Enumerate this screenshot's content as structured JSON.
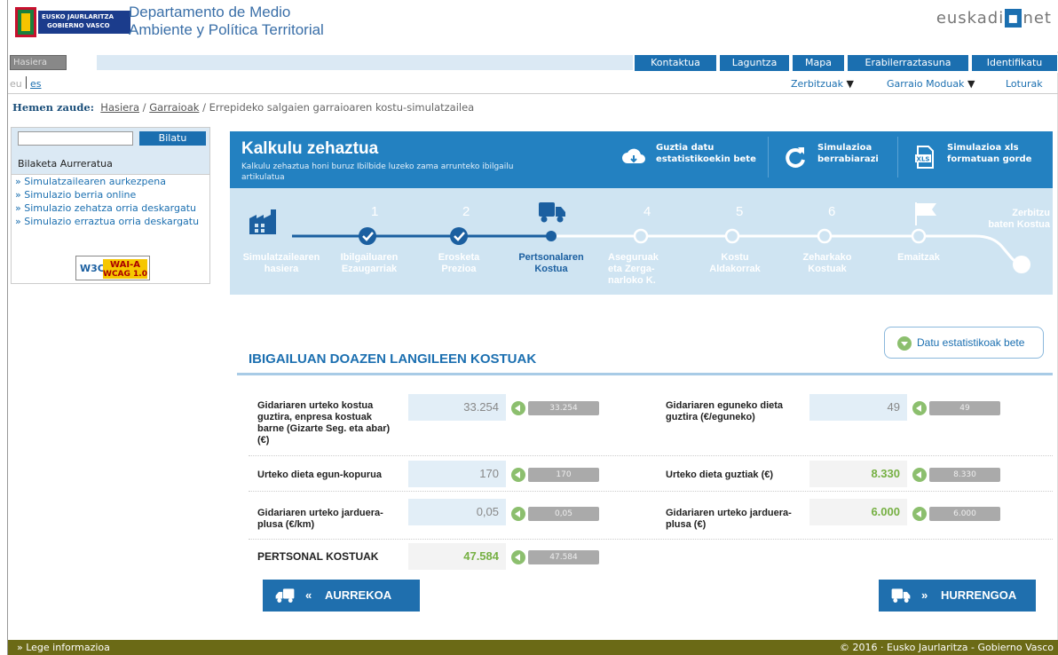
{
  "header": {
    "logo_line1": "EUSKO JAURLARITZA",
    "logo_line2": "GOBIERNO VASCO",
    "dept_line1": "Departamento de Medio",
    "dept_line2": "Ambiente y Política Territorial",
    "portal_pre": "euskadi",
    "portal_post": "net"
  },
  "topbar": {
    "home": "Hasiera",
    "links": [
      "Kontaktua",
      "Laguntza",
      "Mapa",
      "Erabilerraztasuna",
      "Identifikatu"
    ]
  },
  "langbar": {
    "eu": "eu",
    "es": "es",
    "menus": [
      "Zerbitzuak",
      "Garraio Moduak"
    ],
    "loturak": "Loturak"
  },
  "breadcrumb": {
    "label": "Hemen zaude:",
    "items": [
      "Hasiera",
      "Garraioak"
    ],
    "current": "Errepideko salgaien garraioaren kostu-simulatzailea"
  },
  "sidebar": {
    "search_button": "Bilatu",
    "advanced": "Bilaketa Aurreratua",
    "items": [
      "» Simulatzailearen aurkezpena",
      "» Simulazio berria online",
      "» Simulazio zehatza orria deskargatu",
      "» Simulazio erraztua orria deskargatu"
    ],
    "wai_w3c": "W3C",
    "wai_level": "WAI-A",
    "wai_version": "WCAG 1.0"
  },
  "banner": {
    "title": "Kalkulu zehaztua",
    "subtitle": "Kalkulu zehaztua honi buruz Ibilbide luzeko zama arrunteko ibilgailu artikulatua",
    "actions": [
      {
        "line1": "Guztia datu",
        "line2": "estatistikoekin bete"
      },
      {
        "line1": "Simulazioa",
        "line2": "berrabiarazi"
      },
      {
        "line1": "Simulazioa xls",
        "line2": "formatuan gorde"
      }
    ]
  },
  "steps": {
    "numbers": [
      "1",
      "2",
      "4",
      "5",
      "6"
    ],
    "labels": [
      [
        "Simulatzailearen",
        "hasiera"
      ],
      [
        "Ibilgailuaren",
        "Ezaugarriak"
      ],
      [
        "Erosketa",
        "Prezioa"
      ],
      [
        "Pertsonalaren",
        "Kostua"
      ],
      [
        "Aseguruak",
        "eta Zerga-",
        "narloko K."
      ],
      [
        "Kostu",
        "Aldakorrak"
      ],
      [
        "Zeharkako",
        "Kostuak"
      ],
      [
        "Emaitzak"
      ],
      [
        "Zerbitzu",
        "baten Kostua"
      ]
    ],
    "active_index": 3
  },
  "section": {
    "title": "IBIGAILUAN DOAZEN LANGILEEN KOSTUAK",
    "stats_button": "Datu estatistikoak bete"
  },
  "fields": {
    "f1": {
      "label": "Gidariaren urteko kostua guztira, enpresa kostuak barne (Gizarte Seg. eta abar) (€)",
      "value": "33.254",
      "ref": "33.254"
    },
    "f2": {
      "label": "Gidariaren eguneko dieta guztira (€/eguneko)",
      "value": "49",
      "ref": "49"
    },
    "f3": {
      "label": "Urteko dieta egun-kopurua",
      "value": "170",
      "ref": "170"
    },
    "f4": {
      "label": "Urteko dieta guztiak (€)",
      "value": "8.330",
      "ref": "8.330"
    },
    "f5": {
      "label": "Gidariaren urteko jarduera-plusa (€/km)",
      "value": "0,05",
      "ref": "0,05"
    },
    "f6": {
      "label": "Gidariaren urteko jarduera-plusa (€)",
      "value": "6.000",
      "ref": "6.000"
    },
    "f7": {
      "label": "PERTSONAL KOSTUAK",
      "value": "47.584",
      "ref": "47.584"
    }
  },
  "nav": {
    "prev": "AURREKOA",
    "next": "HURRENGOA"
  },
  "footer": {
    "legal": "Lege informazioa",
    "copyright": "© 2016 · Eusko Jaurlaritza - Gobierno Vasco"
  },
  "colors": {
    "primary": "#2381c1",
    "steps_bg": "#cfe4f2",
    "accent_green": "#8cbf6e",
    "footer": "#6b6a16"
  }
}
